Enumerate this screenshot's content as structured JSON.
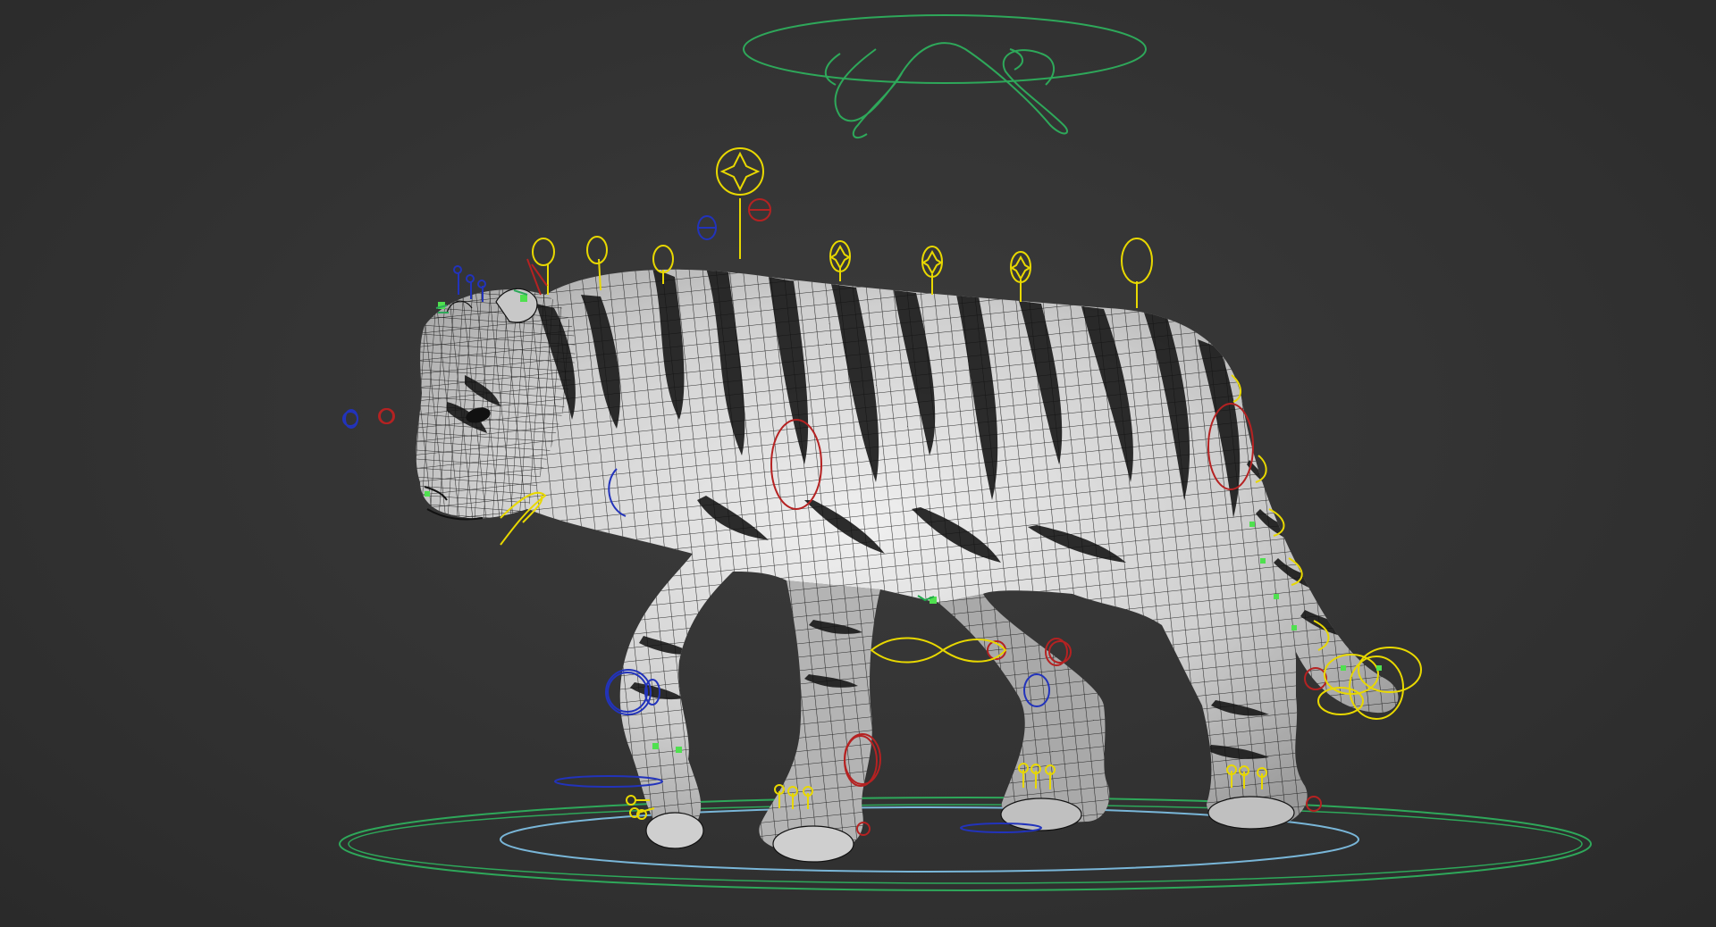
{
  "viewport": {
    "background_color": "#363636",
    "view": "3d-perspective-viewport"
  },
  "scene": {
    "model": "tiger-character-mesh",
    "display_mode": "shaded-with-wireframe",
    "mesh_color": "#d8d8d8",
    "stripe_color": "#1a1a1a",
    "wire_color": "#111111"
  },
  "rig": {
    "colors": {
      "fk_controls": "#e8d800",
      "center_controls": "#1fa84a",
      "left_side_controls": "#b52222",
      "right_side_controls": "#2233bb",
      "ground_rings": "#2ea85a",
      "ground_inner_ring": "#79b6d8",
      "selected_joints": "#4fe04f"
    },
    "controls": [
      "master-root-control",
      "body-offset-control",
      "head-control",
      "neck-controls",
      "spine-controls",
      "hip-control",
      "tail-controls",
      "front-leg-ik-controls",
      "rear-leg-ik-controls",
      "toe-controls",
      "eye-aim-controls",
      "jaw-control",
      "ear-controls"
    ]
  }
}
